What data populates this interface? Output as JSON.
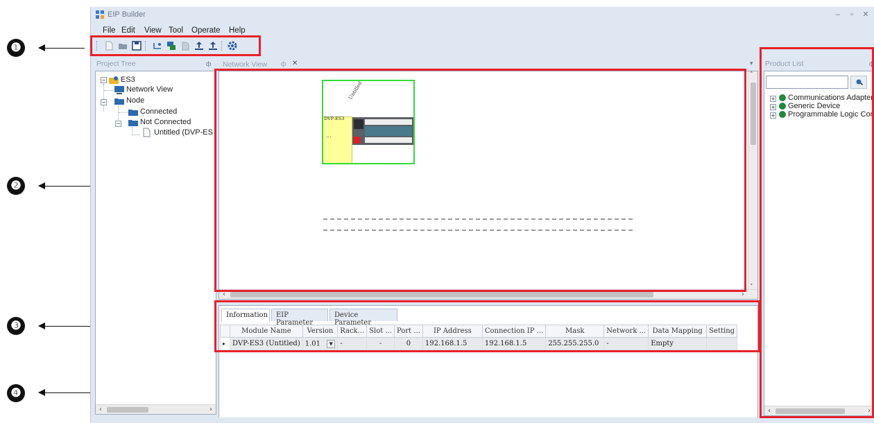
{
  "window": {
    "title": "EIP Builder",
    "controls": [
      "–",
      "▫",
      "✕"
    ]
  },
  "menu": [
    "File",
    "Edit",
    "View",
    "Tool",
    "Operate",
    "Help"
  ],
  "toolbar": {
    "buttons": [
      "new-file-icon",
      "open-folder-icon",
      "save-icon",
      "scan-network-icon",
      "online-devices-icon",
      "monitor-icon",
      "upload-icon",
      "download-icon",
      "settings-icon"
    ]
  },
  "callouts": [
    "❶",
    "❷",
    "❸",
    "❹"
  ],
  "project_tree": {
    "header": "Project Tree",
    "pin": "ф",
    "items": {
      "root": "ES3",
      "network_view": "Network View",
      "node": "Node",
      "connected": "Connected",
      "not_connected": "Not Connected",
      "device": "Untitled (DVP-ES"
    }
  },
  "network_view": {
    "tab_label": "Network View",
    "tab_pin": "ф",
    "tab_close": "✕",
    "dropdown": "▾",
    "device_model": "DVP-ES3",
    "device_name": "Untitled",
    "dots": "..."
  },
  "bottom_panel": {
    "tabs": [
      "Information",
      "EIP Parameter",
      "Device Parameter"
    ],
    "columns": [
      "",
      "Module Name",
      "Version",
      "Rack...",
      "Slot ...",
      "Port ...",
      "IP Address",
      "Connection IP ...",
      "Mask",
      "Network ...",
      "Data Mapping",
      "Setting"
    ],
    "row": {
      "indicator": "▸",
      "module_name": "DVP-ES3 (Untitled)",
      "version": "1.01",
      "rack": "-",
      "slot": "-",
      "port": "0",
      "ip_address": "192.168.1.5",
      "connection_ip": "192.168.1.5",
      "mask": "255.255.255.0",
      "network": "-",
      "data_mapping": "Empty",
      "setting": ""
    }
  },
  "product_list": {
    "header": "Product List",
    "pin": "ф",
    "search_value": "",
    "items": [
      "Communications Adapter",
      "Generic Device",
      "Programmable Logic Controller"
    ]
  },
  "colors": {
    "highlight": "#e8202a",
    "module_border": "#33dd33",
    "window_bg": "#dfe7f2"
  }
}
